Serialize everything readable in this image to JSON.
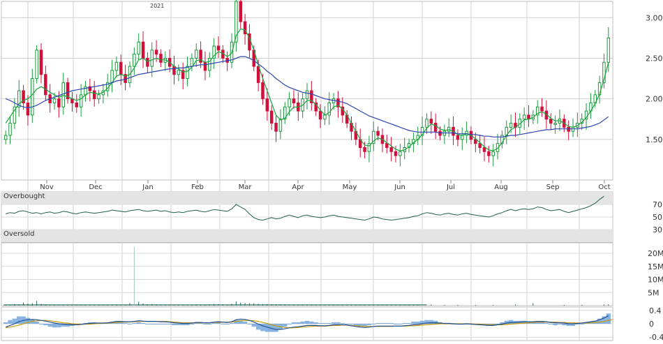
{
  "colors": {
    "up": "#1a9a3c",
    "down": "#d0103a",
    "sma_fast": "#1aa53a",
    "sma_slow": "#2b44b0",
    "rsi": "#1f5f4a",
    "volume": "#1f6b5a",
    "macd_line": "#1f4f8f",
    "macd_signal": "#c89a10",
    "macd_hist": "#6aa0d8",
    "band": "#e4e4e4",
    "grid": "#cfcfcf"
  },
  "chart_data": [
    {
      "type": "candlestick",
      "name": "price",
      "year_label": "2021",
      "x_labels": [
        "Nov",
        "Dec",
        "Jan",
        "Feb",
        "Mar",
        "Apr",
        "May",
        "Jun",
        "Jul",
        "Aug",
        "Sep",
        "Oct"
      ],
      "y_ticks": [
        "3.00",
        "2.50",
        "2.00",
        "1.50"
      ],
      "ylim": [
        1.0,
        3.2
      ],
      "grid": true,
      "close": [
        1.55,
        1.7,
        1.9,
        2.1,
        1.95,
        1.8,
        2.25,
        2.6,
        2.3,
        2.05,
        1.95,
        2.0,
        1.9,
        2.2,
        2.0,
        1.95,
        1.9,
        2.05,
        2.15,
        2.1,
        2.0,
        2.05,
        2.1,
        2.2,
        2.35,
        2.45,
        2.3,
        2.2,
        2.4,
        2.55,
        2.7,
        2.5,
        2.4,
        2.6,
        2.55,
        2.45,
        2.5,
        2.4,
        2.3,
        2.35,
        2.25,
        2.4,
        2.5,
        2.6,
        2.45,
        2.35,
        2.5,
        2.65,
        2.6,
        2.5,
        2.45,
        2.7,
        3.2,
        2.95,
        2.8,
        2.6,
        2.4,
        2.2,
        2.0,
        1.85,
        1.7,
        1.6,
        1.75,
        1.9,
        2.0,
        1.95,
        1.85,
        2.0,
        2.1,
        1.95,
        1.85,
        1.75,
        1.8,
        1.95,
        2.0,
        1.9,
        1.8,
        1.7,
        1.6,
        1.5,
        1.4,
        1.35,
        1.45,
        1.6,
        1.55,
        1.45,
        1.4,
        1.35,
        1.3,
        1.35,
        1.4,
        1.45,
        1.5,
        1.55,
        1.65,
        1.75,
        1.7,
        1.6,
        1.55,
        1.6,
        1.65,
        1.55,
        1.5,
        1.55,
        1.6,
        1.5,
        1.45,
        1.4,
        1.35,
        1.3,
        1.35,
        1.45,
        1.55,
        1.65,
        1.7,
        1.65,
        1.75,
        1.8,
        1.75,
        1.8,
        1.9,
        1.85,
        1.75,
        1.7,
        1.7,
        1.75,
        1.65,
        1.6,
        1.65,
        1.7,
        1.75,
        1.85,
        1.95,
        2.05,
        2.2,
        2.45,
        2.75
      ],
      "series": [
        {
          "name": "",
          "values": [
            1.7,
            1.78,
            1.86,
            1.94,
            1.98,
            2.0,
            2.05,
            2.12,
            2.15,
            2.12,
            2.08,
            2.05,
            2.02,
            2.04,
            2.03,
            2.0,
            1.98,
            2.0,
            2.05,
            2.08,
            2.07,
            2.06,
            2.08,
            2.13,
            2.2,
            2.28,
            2.3,
            2.28,
            2.3,
            2.38,
            2.48,
            2.5,
            2.46,
            2.48,
            2.5,
            2.48,
            2.48,
            2.45,
            2.4,
            2.37,
            2.33,
            2.34,
            2.39,
            2.47,
            2.48,
            2.45,
            2.46,
            2.53,
            2.58,
            2.56,
            2.52,
            2.56,
            2.78,
            2.86,
            2.85,
            2.75,
            2.6,
            2.42,
            2.25,
            2.1,
            1.95,
            1.8,
            1.74,
            1.76,
            1.84,
            1.9,
            1.9,
            1.92,
            1.98,
            1.98,
            1.93,
            1.86,
            1.8,
            1.83,
            1.9,
            1.92,
            1.88,
            1.8,
            1.7,
            1.6,
            1.5,
            1.43,
            1.42,
            1.48,
            1.52,
            1.5,
            1.46,
            1.42,
            1.38,
            1.36,
            1.37,
            1.41,
            1.46,
            1.5,
            1.56,
            1.64,
            1.69,
            1.67,
            1.63,
            1.61,
            1.62,
            1.6,
            1.56,
            1.55,
            1.57,
            1.55,
            1.51,
            1.46,
            1.41,
            1.37,
            1.36,
            1.39,
            1.46,
            1.55,
            1.62,
            1.65,
            1.69,
            1.74,
            1.75,
            1.77,
            1.82,
            1.84,
            1.81,
            1.76,
            1.73,
            1.73,
            1.7,
            1.66,
            1.65,
            1.67,
            1.71,
            1.77,
            1.85,
            1.94,
            2.06,
            2.24,
            2.45
          ]
        },
        {
          "name": "",
          "values": [
            2.0,
            1.98,
            1.95,
            1.92,
            1.9,
            1.89,
            1.9,
            1.92,
            1.95,
            1.98,
            2.0,
            2.02,
            2.04,
            2.06,
            2.08,
            2.1,
            2.11,
            2.12,
            2.13,
            2.14,
            2.15,
            2.16,
            2.17,
            2.18,
            2.2,
            2.22,
            2.23,
            2.24,
            2.26,
            2.28,
            2.3,
            2.31,
            2.32,
            2.33,
            2.34,
            2.35,
            2.36,
            2.37,
            2.37,
            2.38,
            2.38,
            2.39,
            2.4,
            2.41,
            2.42,
            2.42,
            2.43,
            2.44,
            2.45,
            2.46,
            2.47,
            2.48,
            2.5,
            2.52,
            2.52,
            2.5,
            2.47,
            2.43,
            2.39,
            2.34,
            2.3,
            2.25,
            2.21,
            2.17,
            2.14,
            2.12,
            2.1,
            2.08,
            2.07,
            2.06,
            2.04,
            2.02,
            2.0,
            1.99,
            1.98,
            1.97,
            1.96,
            1.94,
            1.91,
            1.88,
            1.85,
            1.82,
            1.79,
            1.77,
            1.75,
            1.73,
            1.71,
            1.69,
            1.67,
            1.65,
            1.63,
            1.61,
            1.6,
            1.59,
            1.59,
            1.59,
            1.59,
            1.59,
            1.58,
            1.58,
            1.58,
            1.58,
            1.57,
            1.57,
            1.57,
            1.56,
            1.56,
            1.55,
            1.54,
            1.54,
            1.53,
            1.53,
            1.53,
            1.54,
            1.55,
            1.55,
            1.56,
            1.57,
            1.58,
            1.59,
            1.6,
            1.61,
            1.62,
            1.62,
            1.63,
            1.63,
            1.63,
            1.63,
            1.63,
            1.63,
            1.64,
            1.65,
            1.66,
            1.68,
            1.7,
            1.74,
            1.78
          ]
        }
      ]
    },
    {
      "type": "line",
      "name": "rsi",
      "labels": {
        "overbought": "Overbought",
        "oversold": "Oversold"
      },
      "y_ticks": [
        "70",
        "50",
        "30"
      ],
      "ylim": [
        10,
        90
      ],
      "band_overbought": [
        70,
        90
      ],
      "band_oversold": [
        10,
        30
      ],
      "values": [
        55,
        57,
        56,
        59,
        60,
        58,
        56,
        57,
        55,
        57,
        58,
        56,
        57,
        59,
        58,
        56,
        55,
        57,
        58,
        57,
        56,
        57,
        58,
        59,
        61,
        60,
        59,
        58,
        60,
        61,
        62,
        60,
        59,
        60,
        61,
        59,
        60,
        58,
        57,
        58,
        57,
        59,
        60,
        61,
        59,
        58,
        60,
        62,
        61,
        60,
        59,
        63,
        70,
        66,
        62,
        55,
        49,
        46,
        45,
        47,
        49,
        47,
        48,
        51,
        53,
        51,
        49,
        52,
        53,
        51,
        50,
        49,
        50,
        52,
        53,
        51,
        50,
        49,
        48,
        47,
        46,
        45,
        47,
        50,
        49,
        47,
        46,
        45,
        46,
        47,
        48,
        49,
        51,
        52,
        55,
        57,
        56,
        54,
        53,
        55,
        56,
        54,
        53,
        55,
        56,
        54,
        53,
        52,
        51,
        50,
        52,
        55,
        57,
        60,
        62,
        60,
        62,
        63,
        62,
        63,
        66,
        65,
        62,
        60,
        61,
        62,
        59,
        57,
        59,
        61,
        63,
        65,
        68,
        72,
        78,
        83
      ]
    },
    {
      "type": "bar",
      "name": "volume",
      "y_ticks": [
        "20M",
        "15M",
        "10M",
        "5M"
      ],
      "ylim": [
        0,
        24
      ],
      "values": [
        0.4,
        0.3,
        0.6,
        0.5,
        1.2,
        0.8,
        0.9,
        1.8,
        0.7,
        0.5,
        0.4,
        0.3,
        0.3,
        0.4,
        0.3,
        0.3,
        0.2,
        0.3,
        0.4,
        0.3,
        0.3,
        0.3,
        0.3,
        0.3,
        0.4,
        0.5,
        0.4,
        0.3,
        1.0,
        22.5,
        1.5,
        0.8,
        0.5,
        0.6,
        0.5,
        0.4,
        0.4,
        0.4,
        0.3,
        0.4,
        0.3,
        0.4,
        0.4,
        0.5,
        0.4,
        0.4,
        0.5,
        0.6,
        0.6,
        0.5,
        0.4,
        0.7,
        1.6,
        1.2,
        1.0,
        0.9,
        0.8,
        0.7,
        0.6,
        0.6,
        0.5,
        0.5,
        0.5,
        0.5,
        0.4,
        0.4,
        0.4,
        0.4,
        0.4,
        0.4,
        0.4,
        0.3,
        0.3,
        0.3,
        0.3,
        0.3,
        0.3,
        0.3,
        0.3,
        0.3,
        0.3,
        0.3,
        0.3,
        0.3,
        0.3,
        0.3,
        0.3,
        0.3,
        0.3,
        0.3,
        0.3,
        0.3,
        0.3,
        0.3,
        0,
        0,
        0.4,
        0,
        0,
        0.3,
        0,
        0,
        0.3,
        0,
        0,
        0,
        0.3,
        0,
        0,
        0,
        0.3,
        0,
        0,
        0,
        0,
        0.4,
        0,
        0,
        0,
        0.9,
        0,
        0,
        0,
        0,
        0,
        0,
        0.3,
        0,
        0,
        0,
        0.3,
        0,
        0,
        0,
        0,
        0.4,
        0.5
      ]
    },
    {
      "type": "line",
      "name": "macd",
      "y_ticks": [
        "0.4",
        "0",
        "-0.4"
      ],
      "ylim": [
        -0.5,
        0.5
      ],
      "series": [
        {
          "name": "",
          "values": [
            -0.1,
            -0.05,
            0.0,
            0.06,
            0.1,
            0.12,
            0.13,
            0.12,
            0.1,
            0.08,
            0.05,
            0.02,
            0.0,
            -0.01,
            -0.02,
            -0.03,
            -0.03,
            -0.02,
            0.0,
            0.01,
            0.02,
            0.02,
            0.02,
            0.03,
            0.05,
            0.07,
            0.07,
            0.06,
            0.06,
            0.07,
            0.09,
            0.08,
            0.07,
            0.07,
            0.07,
            0.06,
            0.06,
            0.05,
            0.03,
            0.02,
            0.01,
            0.01,
            0.02,
            0.04,
            0.04,
            0.03,
            0.03,
            0.05,
            0.06,
            0.05,
            0.04,
            0.06,
            0.12,
            0.14,
            0.13,
            0.1,
            0.05,
            -0.01,
            -0.06,
            -0.1,
            -0.14,
            -0.17,
            -0.17,
            -0.15,
            -0.12,
            -0.1,
            -0.09,
            -0.07,
            -0.05,
            -0.05,
            -0.05,
            -0.06,
            -0.06,
            -0.05,
            -0.03,
            -0.03,
            -0.03,
            -0.04,
            -0.06,
            -0.08,
            -0.1,
            -0.11,
            -0.1,
            -0.08,
            -0.07,
            -0.07,
            -0.07,
            -0.07,
            -0.07,
            -0.07,
            -0.06,
            -0.05,
            -0.03,
            -0.02,
            0.0,
            0.02,
            0.03,
            0.03,
            0.02,
            0.01,
            0.01,
            0.0,
            -0.01,
            -0.01,
            0.0,
            -0.01,
            -0.02,
            -0.03,
            -0.04,
            -0.05,
            -0.05,
            -0.03,
            -0.01,
            0.02,
            0.04,
            0.04,
            0.05,
            0.06,
            0.06,
            0.06,
            0.07,
            0.07,
            0.06,
            0.04,
            0.03,
            0.03,
            0.02,
            0.0,
            0.0,
            0.01,
            0.02,
            0.04,
            0.06,
            0.08,
            0.12,
            0.17,
            0.24
          ]
        },
        {
          "name": "",
          "values": [
            -0.12,
            -0.1,
            -0.07,
            -0.04,
            0.0,
            0.04,
            0.07,
            0.09,
            0.1,
            0.1,
            0.09,
            0.07,
            0.05,
            0.03,
            0.02,
            0.0,
            -0.01,
            -0.01,
            -0.01,
            -0.01,
            0.0,
            0.01,
            0.01,
            0.02,
            0.03,
            0.04,
            0.05,
            0.05,
            0.06,
            0.06,
            0.07,
            0.07,
            0.07,
            0.07,
            0.07,
            0.07,
            0.07,
            0.06,
            0.05,
            0.04,
            0.03,
            0.03,
            0.03,
            0.03,
            0.03,
            0.03,
            0.03,
            0.04,
            0.04,
            0.05,
            0.05,
            0.05,
            0.07,
            0.09,
            0.1,
            0.1,
            0.09,
            0.07,
            0.04,
            0.01,
            -0.03,
            -0.06,
            -0.09,
            -0.11,
            -0.12,
            -0.12,
            -0.11,
            -0.1,
            -0.09,
            -0.08,
            -0.07,
            -0.07,
            -0.07,
            -0.06,
            -0.05,
            -0.05,
            -0.04,
            -0.04,
            -0.05,
            -0.06,
            -0.07,
            -0.08,
            -0.08,
            -0.08,
            -0.08,
            -0.08,
            -0.08,
            -0.08,
            -0.07,
            -0.07,
            -0.07,
            -0.06,
            -0.06,
            -0.05,
            -0.04,
            -0.03,
            -0.02,
            -0.01,
            0.0,
            0.0,
            0.0,
            0.0,
            0.0,
            0.0,
            0.0,
            0.0,
            -0.01,
            -0.01,
            -0.02,
            -0.03,
            -0.03,
            -0.03,
            -0.03,
            -0.02,
            -0.01,
            0.0,
            0.01,
            0.02,
            0.03,
            0.04,
            0.05,
            0.05,
            0.05,
            0.05,
            0.05,
            0.04,
            0.04,
            0.03,
            0.03,
            0.02,
            0.02,
            0.02,
            0.03,
            0.04,
            0.05,
            0.07,
            0.1,
            0.13
          ]
        }
      ]
    }
  ]
}
